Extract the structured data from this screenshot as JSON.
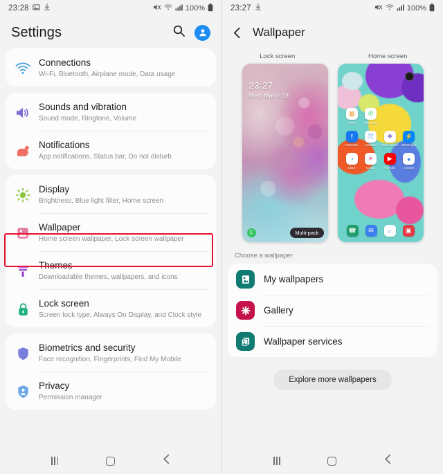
{
  "left": {
    "statusbar": {
      "time": "23:28",
      "icons_left": [
        "image-icon",
        "download-icon"
      ],
      "mute_icon": "mute-icon",
      "wifi_icon": "wifi-icon",
      "signal_icon": "signal-icon",
      "battery_text": "100%",
      "battery_icon": "battery-icon"
    },
    "header": {
      "title": "Settings",
      "search_icon": "search-icon",
      "avatar_icon": "account-avatar"
    },
    "groups": [
      {
        "items": [
          {
            "title": "Connections",
            "sub": "Wi-Fi, Bluetooth, Airplane mode, Data usage",
            "icon": "wifi-icon",
            "color": "#4da3de"
          }
        ]
      },
      {
        "items": [
          {
            "title": "Sounds and vibration",
            "sub": "Sound mode, Ringtone, Volume",
            "icon": "speaker-icon",
            "color": "#7b6fd4"
          },
          {
            "title": "Notifications",
            "sub": "App notifications, Status bar, Do not disturb",
            "icon": "notification-icon",
            "color": "#ef6f63"
          }
        ]
      },
      {
        "items": [
          {
            "title": "Display",
            "sub": "Brightness, Blue light filter, Home screen",
            "icon": "brightness-icon",
            "color": "#8cc63f"
          },
          {
            "title": "Wallpaper",
            "sub": "Home screen wallpaper, Lock screen wallpaper",
            "icon": "wallpaper-icon",
            "color": "#e27ba0"
          },
          {
            "title": "Themes",
            "sub": "Downloadable themes, wallpapers, and icons",
            "icon": "themes-brush-icon",
            "color": "#a857d4"
          },
          {
            "title": "Lock screen",
            "sub": "Screen lock type, Always On Display, and Clock style",
            "icon": "lock-icon",
            "color": "#2bb druk"
          }
        ]
      },
      {
        "items": [
          {
            "title": "Biometrics and security",
            "sub": "Face recognition, Fingerprints, Find My Mobile",
            "icon": "shield-icon",
            "color": "#7b7fe0"
          },
          {
            "title": "Privacy",
            "sub": "Permission manager",
            "icon": "privacy-shield-icon",
            "color": "#6fa8e8"
          }
        ]
      }
    ],
    "highlight": {
      "target": "Wallpaper",
      "color": "#e8112d"
    },
    "navbar": {
      "recents": "recents-icon",
      "home": "home-icon",
      "back": "back-icon"
    }
  },
  "right": {
    "statusbar": {
      "time": "23:27",
      "icons_left": [
        "download-icon"
      ],
      "battery_text": "100%"
    },
    "header": {
      "back_icon": "back-chevron-icon",
      "title": "Wallpaper"
    },
    "previews": {
      "lock_label": "Lock screen",
      "home_label": "Home screen",
      "lock": {
        "time": "23:27",
        "date": "Wed, March 18",
        "badge": "C",
        "tag": "Multi-pack"
      },
      "home": {
        "apps": [
          {
            "label": "Video",
            "glyph": "▦",
            "color": "#ffffff",
            "fg": "#f2a33c"
          },
          {
            "label": "WhatsApp",
            "glyph": "✆",
            "color": "#ffffff",
            "fg": "#25d366"
          },
          {
            "label": "Facebook",
            "glyph": "f",
            "color": "#1877f2",
            "fg": "#ffffff"
          },
          {
            "label": "Calendar",
            "glyph": "☷",
            "color": "#ffffff",
            "fg": "#2b8ae0"
          },
          {
            "label": "Game Launcher",
            "glyph": "❖",
            "color": "#ffffff",
            "fg": "#7b5ad4"
          },
          {
            "label": "Messenger",
            "glyph": "⚡",
            "color": "#0084ff",
            "fg": "#ffffff"
          },
          {
            "label": "Clock",
            "glyph": "◔",
            "color": "#ffffff",
            "fg": "#4a6fd4"
          },
          {
            "label": "Galaxy",
            "glyph": "✳",
            "color": "#ffffff",
            "fg": "#e0457b"
          },
          {
            "label": "YouTube",
            "glyph": "▶",
            "color": "#ff0000",
            "fg": "#ffffff"
          },
          {
            "label": "Chrome",
            "glyph": "●",
            "color": "#ffffff",
            "fg": "#4285f4"
          }
        ],
        "dock": [
          {
            "label": "Phone",
            "glyph": "☎",
            "color": "#1f9d6b",
            "fg": "#ffffff"
          },
          {
            "label": "Messages",
            "glyph": "✉",
            "color": "#3b7ff0",
            "fg": "#ffffff"
          },
          {
            "label": "Chat",
            "glyph": "○",
            "color": "#ffffff",
            "fg": "#3b7ff0"
          },
          {
            "label": "Camera",
            "glyph": "▣",
            "color": "#e63946",
            "fg": "#ffffff"
          }
        ]
      }
    },
    "choose_label": "Choose a wallpaper",
    "choices": [
      {
        "label": "My wallpapers",
        "icon": "my-wallpapers-icon",
        "color": "#0f7b73"
      },
      {
        "label": "Gallery",
        "icon": "gallery-flower-icon",
        "color": "#c5124a"
      },
      {
        "label": "Wallpaper services",
        "icon": "wallpaper-services-icon",
        "color": "#0f7b73"
      }
    ],
    "explore_label": "Explore more wallpapers",
    "navbar": {
      "recents": "recents-icon",
      "home": "home-icon",
      "back": "back-icon"
    }
  }
}
